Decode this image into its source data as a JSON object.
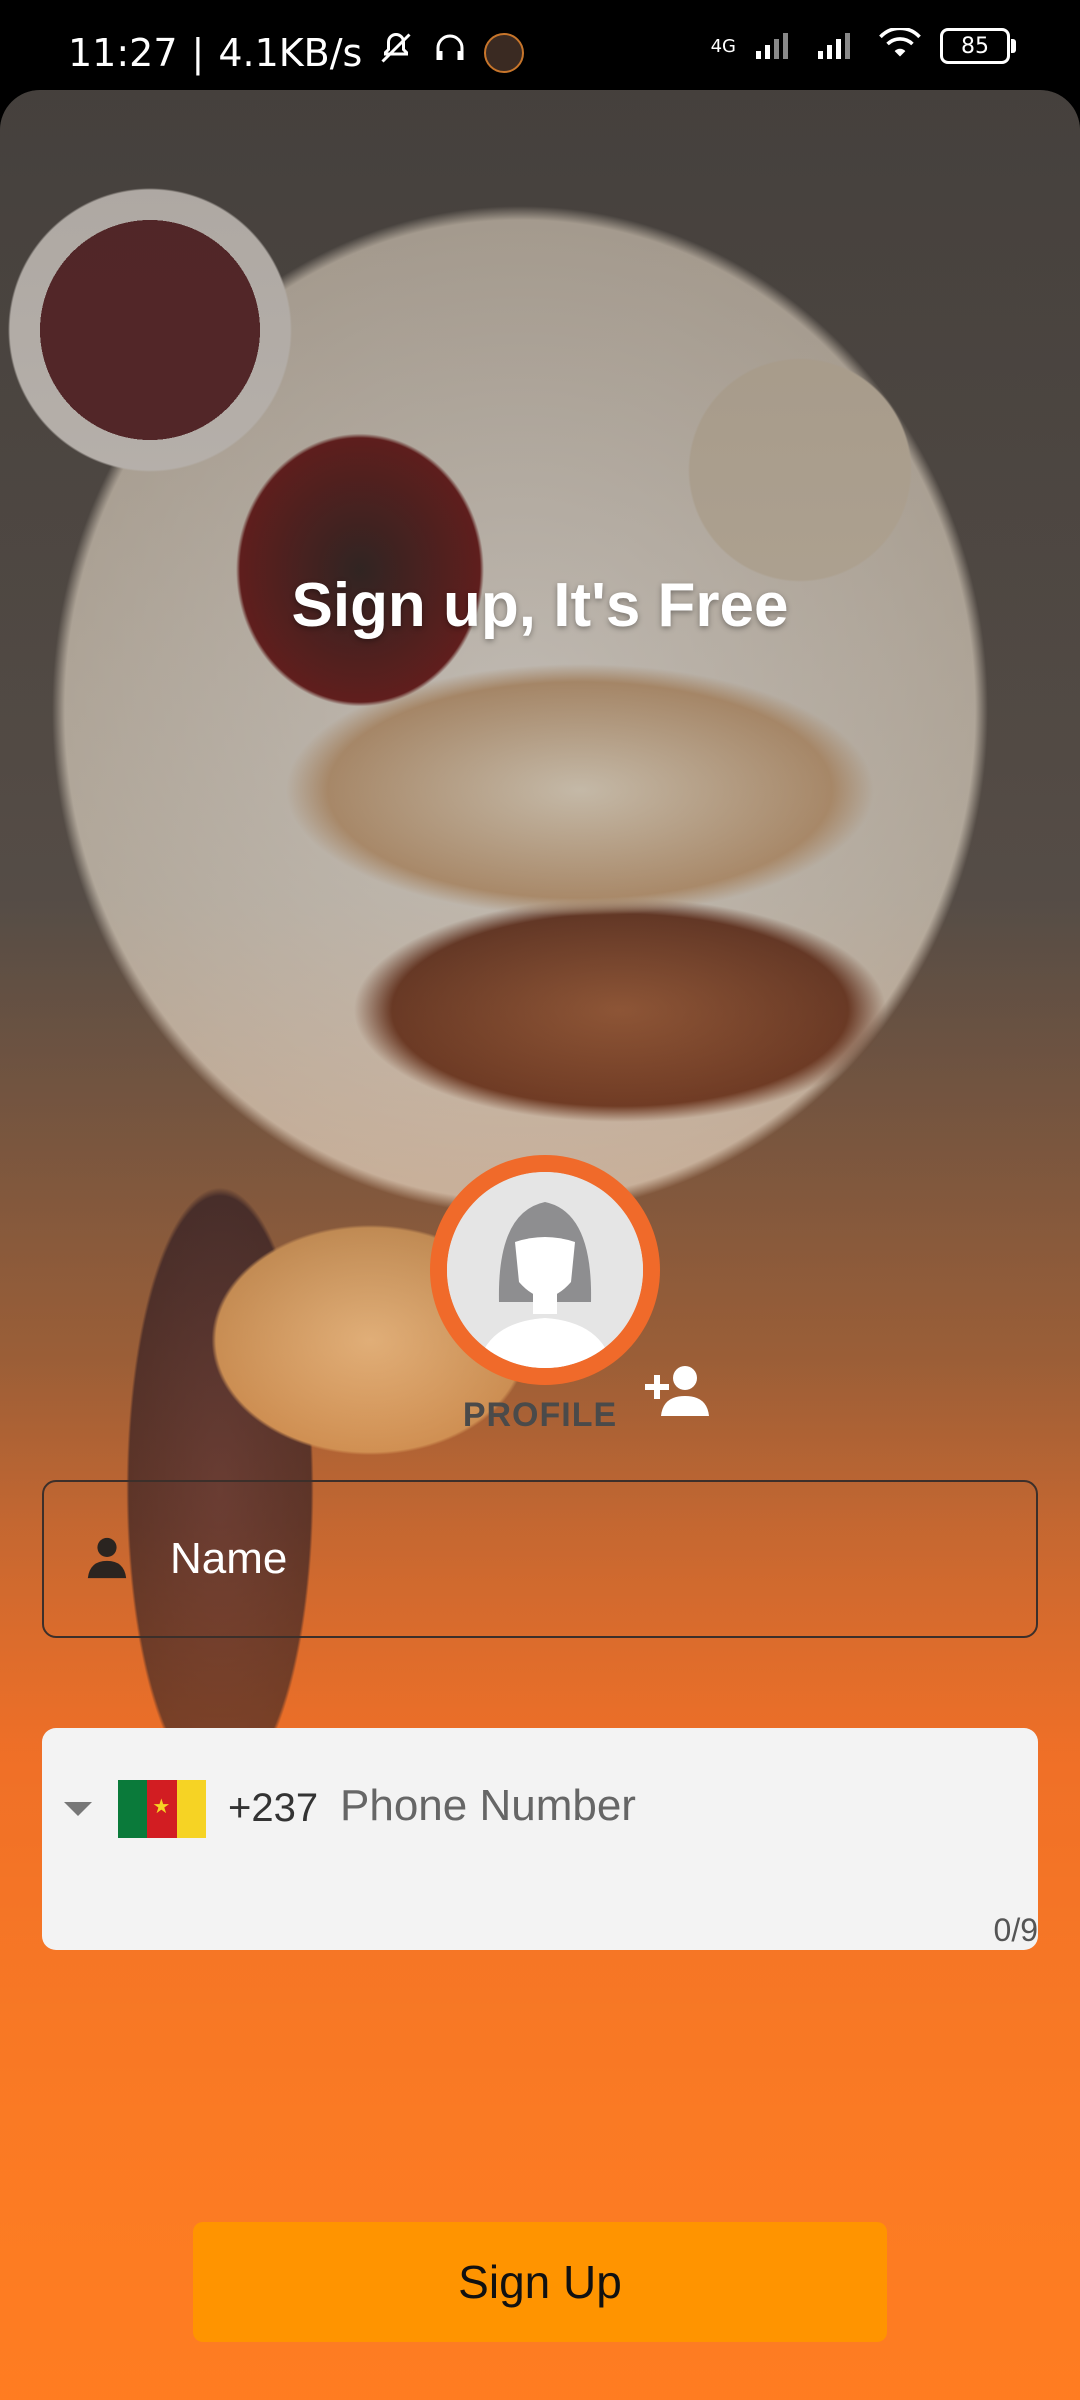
{
  "status_bar": {
    "time": "11:27",
    "network_speed": "4.1KB/s",
    "network_type": "4G",
    "battery": "85",
    "icons": [
      "bell-off-icon",
      "headphones-icon",
      "app-notification-icon",
      "signal-icon",
      "signal-icon-2",
      "wifi-icon",
      "battery-icon"
    ]
  },
  "title": "Sign up, It's Free",
  "profile": {
    "label": "PROFILE",
    "accent_color": "#f06a2a"
  },
  "name_field": {
    "placeholder": "Name"
  },
  "phone_field": {
    "country_code": "+237",
    "placeholder": "Phone Number",
    "counter": "0/9",
    "flag": "cameroon-flag"
  },
  "signup_button": {
    "label": "Sign Up",
    "color": "#ff9400"
  }
}
